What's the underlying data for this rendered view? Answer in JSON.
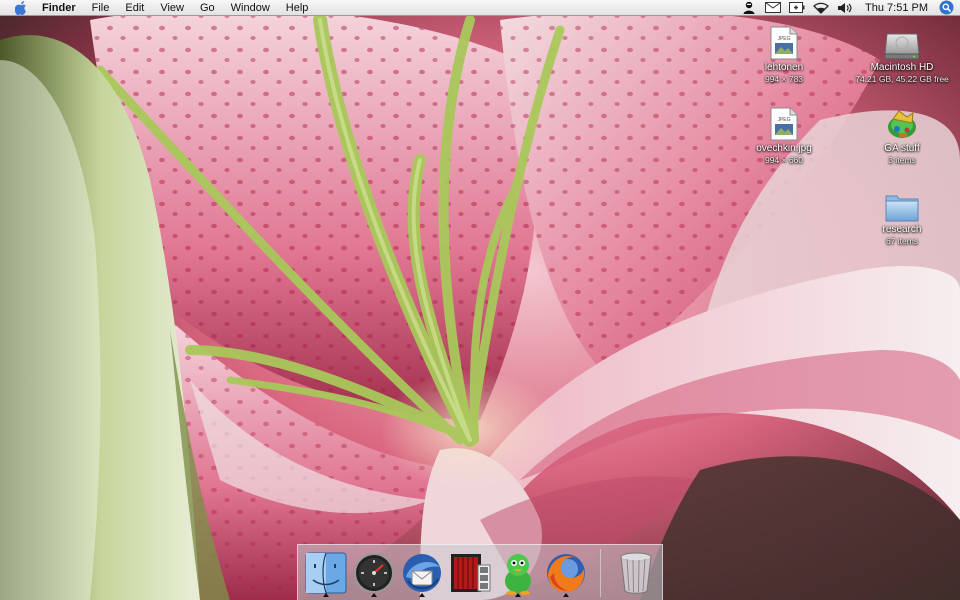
{
  "menubar": {
    "apple_icon": "apple-icon",
    "app_name": "Finder",
    "menus": [
      "File",
      "Edit",
      "View",
      "Go",
      "Window",
      "Help"
    ],
    "status_icons": [
      "user-icon",
      "mail-icon",
      "battery-icon",
      "wifi-icon",
      "volume-icon"
    ],
    "clock": "Thu 7:51 PM",
    "spotlight_icon": "spotlight-icon"
  },
  "desktop": {
    "icons": [
      {
        "label": "lehtonen",
        "sub": "994 × 783",
        "icon": "jpeg-file-icon"
      },
      {
        "label": "Macintosh HD",
        "sub": "74.21 GB, 45.22 GB free",
        "icon": "hard-drive-icon"
      },
      {
        "label": "ovechkin.jpg",
        "sub": "994 × 660",
        "icon": "jpeg-file-icon"
      },
      {
        "label": "GA stuff",
        "sub": "3 items",
        "icon": "folder-stuff-icon"
      },
      {
        "label": "research",
        "sub": "67 items",
        "icon": "folder-icon"
      }
    ],
    "file_badge": "JPEG"
  },
  "dock": {
    "items": [
      {
        "name": "finder-icon",
        "running": true
      },
      {
        "name": "dashboard-icon",
        "running": true
      },
      {
        "name": "thunderbird-icon",
        "running": true
      },
      {
        "name": "photo-booth-icon",
        "running": false
      },
      {
        "name": "adium-icon",
        "running": true
      },
      {
        "name": "firefox-icon",
        "running": true
      },
      {
        "name": "trash-icon",
        "running": false
      }
    ]
  },
  "colors": {
    "petal_pink": "#e0718f",
    "petal_white": "#f1dde0",
    "stamen_green": "#a9c85a",
    "menubar": "#eeeeee"
  }
}
